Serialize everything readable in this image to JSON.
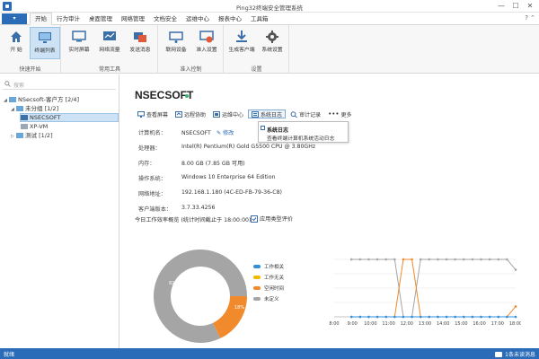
{
  "window": {
    "title": "Ping32终端安全管理系统",
    "controls": [
      "—",
      "☐",
      "✕"
    ]
  },
  "menu": {
    "button_label": "▾",
    "tabs": [
      {
        "label": "开始",
        "active": true
      },
      {
        "label": "行为审计",
        "active": false
      },
      {
        "label": "桌面管理",
        "active": false
      },
      {
        "label": "网络管理",
        "active": false
      },
      {
        "label": "文档安全",
        "active": false
      },
      {
        "label": "运维中心",
        "active": false
      },
      {
        "label": "报表中心",
        "active": false
      },
      {
        "label": "工具箱",
        "active": false
      }
    ],
    "help": "? ⌃"
  },
  "ribbon": {
    "groups": [
      {
        "label": "快速开始",
        "buttons": [
          {
            "label": "开 始",
            "icon": "home-icon"
          },
          {
            "label": "终端列表",
            "icon": "terminal-list-icon",
            "active": true
          }
        ]
      },
      {
        "label": "常用工具",
        "buttons": [
          {
            "label": "实时屏幕",
            "icon": "monitor-icon"
          },
          {
            "label": "网络流量",
            "icon": "network-traffic-icon"
          },
          {
            "label": "发送消息",
            "icon": "send-message-icon"
          }
        ]
      },
      {
        "label": "准入控制",
        "buttons": [
          {
            "label": "联网设备",
            "icon": "network-device-icon"
          },
          {
            "label": "准入设置",
            "icon": "access-settings-icon"
          }
        ]
      },
      {
        "label": "设置",
        "buttons": [
          {
            "label": "生成客户端",
            "icon": "download-client-icon"
          },
          {
            "label": "系统设置",
            "icon": "gear-icon"
          }
        ]
      }
    ]
  },
  "sidebar": {
    "search_placeholder": "搜索",
    "tree": [
      {
        "label": "NSecsoft-客户方  [2/4]",
        "level": 0,
        "expanded": true
      },
      {
        "label": "未分组  [1/2]",
        "level": 1,
        "expanded": true
      },
      {
        "label": "NSECSOFT",
        "level": 2,
        "selected": true
      },
      {
        "label": "XP-VM",
        "level": 2
      },
      {
        "label": "测试  [1/2]",
        "level": 1,
        "expanded": false
      }
    ]
  },
  "main": {
    "host_name": "NSECSOFT",
    "actions": [
      {
        "label": "查看屏幕",
        "icon": "screen-icon"
      },
      {
        "label": "远程协助",
        "icon": "remote-assist-icon"
      },
      {
        "label": "运维中心",
        "icon": "ops-center-icon"
      },
      {
        "label": "系统日志",
        "icon": "system-log-icon",
        "highlighted": true
      },
      {
        "label": "审计记录",
        "icon": "audit-record-icon"
      },
      {
        "label": "更多",
        "icon": "more-icon"
      }
    ],
    "info": [
      {
        "label": "计算机名：",
        "value": "NSECSOFT",
        "edit": "修改"
      },
      {
        "label": "处理器：",
        "value": "Intel(R) Pentium(R) Gold G5500 CPU @ 3.80GHz"
      },
      {
        "label": "内存：",
        "value": "8.00 GB (7.85 GB 可用)"
      },
      {
        "label": "操作系统：",
        "value": "Windows 10 Enterprise 64 Edition"
      },
      {
        "label": "网络地址：",
        "value": "192.168.1.180  (4C-ED-FB-79-36-C8)"
      },
      {
        "label": "客户端版本：",
        "value": "3.7.33.4256"
      }
    ],
    "tooltip": {
      "title": "系统日志",
      "description": "查看终端计算机系统活动日志"
    },
    "summary_heading": "今日工作效率概览 (统计时间截止于 18:00:00)",
    "summary_link": "应用类型评价"
  },
  "chart_data": [
    {
      "type": "pie",
      "categories": [
        "工作相关",
        "工作无关",
        "空闲时间",
        "未定义"
      ],
      "values": [
        0,
        0,
        18,
        82
      ],
      "labels": [
        "82%",
        "18%"
      ],
      "colors": [
        "#2f8fdb",
        "#f5b800",
        "#f08a2c",
        "#a5a5a5"
      ]
    },
    {
      "type": "line",
      "x": [
        "8:00",
        "9:00",
        "10:00",
        "11:00",
        "12:00",
        "13:00",
        "14:00",
        "15:00",
        "16:00",
        "17:00",
        "18:00"
      ],
      "series": [
        {
          "color": "#a5a5a5",
          "values": [
            null,
            null,
            100,
            100,
            100,
            100,
            100,
            100,
            0,
            0,
            100,
            100,
            100,
            100,
            100,
            100,
            100,
            100,
            100,
            100,
            100,
            82
          ]
        },
        {
          "color": "#f08a2c",
          "values": [
            null,
            null,
            0,
            0,
            0,
            0,
            0,
            0,
            100,
            100,
            0,
            0,
            0,
            0,
            0,
            0,
            0,
            0,
            0,
            0,
            0,
            18
          ]
        },
        {
          "color": "#2f8fdb",
          "values": [
            null,
            null,
            0,
            0,
            0,
            0,
            0,
            0,
            0,
            0,
            0,
            0,
            0,
            0,
            0,
            0,
            0,
            0,
            0,
            0,
            0,
            0
          ]
        }
      ],
      "ylim": [
        0,
        100
      ],
      "grid": true
    }
  ],
  "status": {
    "left": "就绪",
    "right": "1条未读消息"
  }
}
